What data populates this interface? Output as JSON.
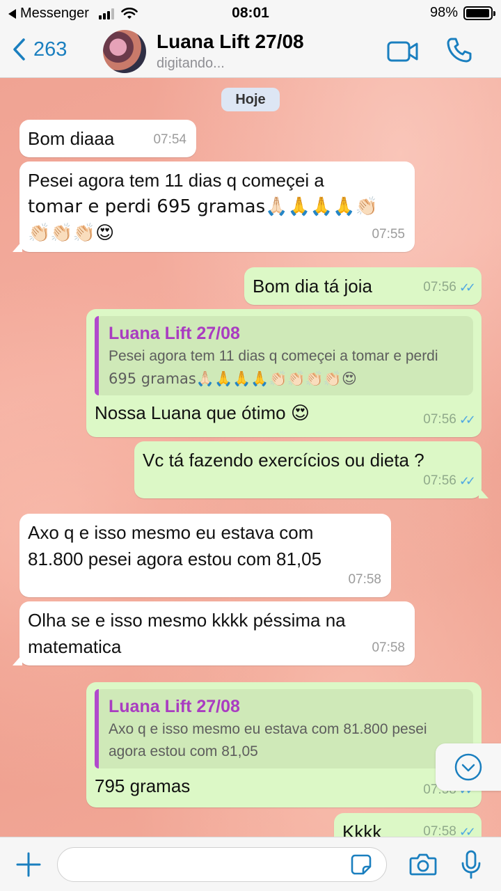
{
  "status_bar": {
    "back_app": "Messenger",
    "time": "08:01",
    "battery": "98%",
    "battery_level": 0.98
  },
  "header": {
    "back_count": "263",
    "contact_name": "Luana Lift 27/08",
    "contact_status": "digitando..."
  },
  "chat": {
    "date_label": "Hoje",
    "messages": [
      {
        "direction": "in",
        "text": "Bom diaaa",
        "time": "07:54"
      },
      {
        "direction": "in",
        "text_lines": [
          "Pesei agora tem 11 dias q começei a",
          "tomar e perdi 695 gramas🙏🏻🙏🙏🙏👏🏻",
          "👏🏻👏🏻👏🏻😍"
        ],
        "time": "07:55"
      },
      {
        "direction": "out",
        "text": "Bom dia tá joia",
        "time": "07:56",
        "read": true
      },
      {
        "direction": "out",
        "quote": {
          "name": "Luana Lift 27/08",
          "text_lines": [
            "Pesei agora tem 11 dias q começei a tomar e perdi",
            "695 gramas🙏🏻🙏🙏🙏👏🏻👏🏻👏🏻👏🏻😍"
          ]
        },
        "text": "Nossa Luana que ótimo 😍",
        "time": "07:56",
        "read": true
      },
      {
        "direction": "out",
        "text": "Vc tá fazendo exercícios ou dieta ?",
        "time": "07:56",
        "read": true
      },
      {
        "direction": "in",
        "text_lines": [
          "Axo q e isso mesmo eu estava com",
          "81.800 pesei agora estou com 81,05"
        ],
        "time": "07:58"
      },
      {
        "direction": "in",
        "text_lines": [
          "Olha se e isso mesmo kkkk péssima na",
          "matematica"
        ],
        "time": "07:58"
      },
      {
        "direction": "out",
        "quote": {
          "name": "Luana Lift 27/08",
          "text_lines": [
            "Axo q e isso mesmo eu estava com 81.800 pesei",
            "agora estou com 81,05"
          ]
        },
        "text": "795 gramas",
        "time": "07:58",
        "read": true
      },
      {
        "direction": "out",
        "text": "Kkkk",
        "time": "07:58",
        "read": true
      }
    ]
  },
  "input": {
    "placeholder": ""
  },
  "colors": {
    "accent": "#1a7fbf",
    "outgoing_bubble": "#dcf8c6",
    "incoming_bubble": "#ffffff",
    "quote_name": "#a93cc1",
    "read_check": "#4fa7e2"
  },
  "icons": [
    "back-chevron-icon",
    "video-call-icon",
    "phone-icon",
    "plus-icon",
    "sticker-icon",
    "camera-icon",
    "microphone-icon",
    "chevron-down-icon",
    "signal-icon",
    "wifi-icon",
    "battery-icon"
  ]
}
